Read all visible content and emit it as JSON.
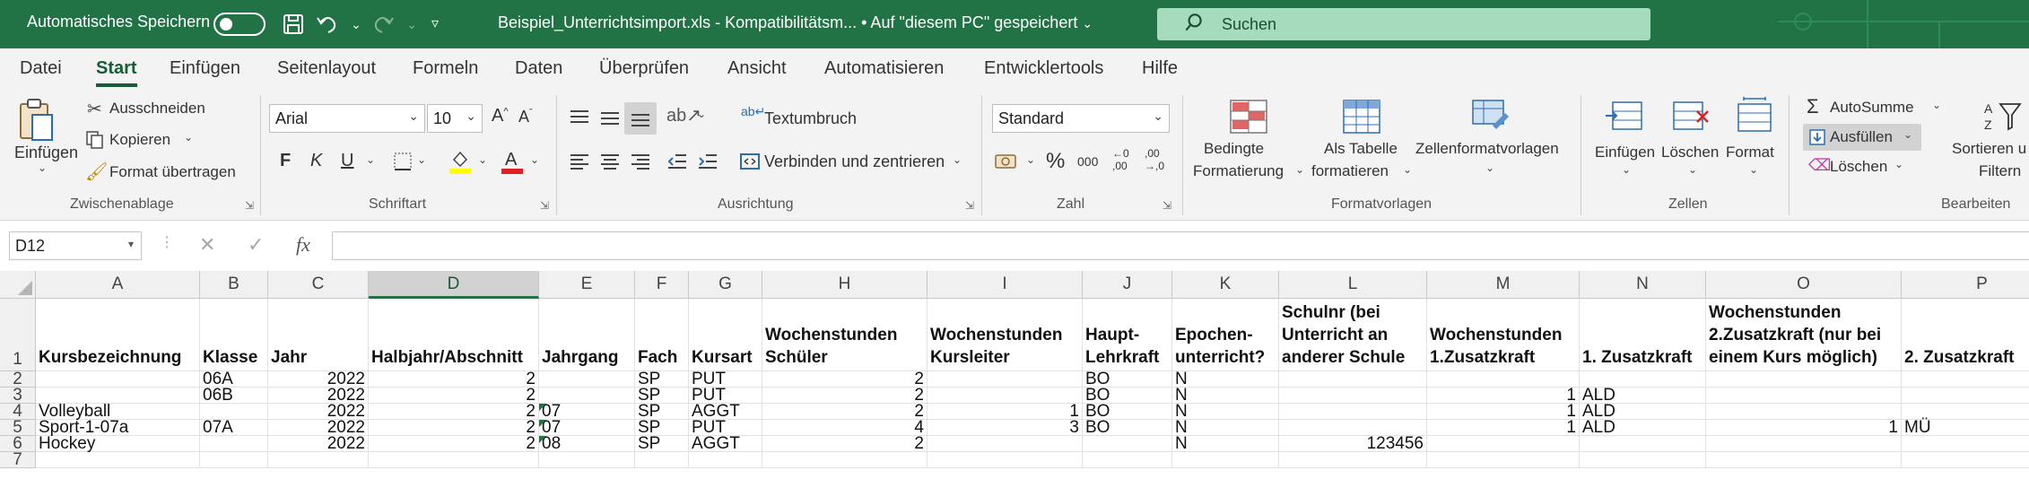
{
  "titlebar": {
    "autosave_label": "Automatisches Speichern",
    "document_title": "Beispiel_Unterrichtsimport.xls  -  Kompatibilitätsm...  •  Auf \"diesem PC\" gespeichert",
    "search_placeholder": "Suchen",
    "icons": [
      "save-icon",
      "undo-icon",
      "redo-icon",
      "customize-icon",
      "search-icon"
    ]
  },
  "menu": {
    "tabs": [
      "Datei",
      "Start",
      "Einfügen",
      "Seitenlayout",
      "Formeln",
      "Daten",
      "Überprüfen",
      "Ansicht",
      "Automatisieren",
      "Entwicklertools",
      "Hilfe"
    ],
    "active": "Start"
  },
  "ribbon": {
    "clipboard": {
      "paste": "Einfügen",
      "cut": "Ausschneiden",
      "copy": "Kopieren",
      "format_painter": "Format übertragen",
      "group": "Zwischenablage"
    },
    "font": {
      "name": "Arial",
      "size": "10",
      "bold": "F",
      "italic": "K",
      "underline": "U",
      "group": "Schriftart"
    },
    "alignment": {
      "wrap": "Textumbruch",
      "merge": "Verbinden und zentrieren",
      "group": "Ausrichtung"
    },
    "number": {
      "format": "Standard",
      "percent": "%",
      "thousands": "000",
      "group": "Zahl"
    },
    "styles": {
      "conditional_1": "Bedingte",
      "conditional_2": "Formatierung",
      "table_1": "Als Tabelle",
      "table_2": "formatieren",
      "cell_styles": "Zellenformatvorlagen",
      "group": "Formatvorlagen"
    },
    "cells": {
      "insert": "Einfügen",
      "delete": "Löschen",
      "format": "Format",
      "group": "Zellen"
    },
    "editing": {
      "autosum": "AutoSumme",
      "fill": "Ausfüllen",
      "clear": "Löschen",
      "sort_1": "Sortieren u",
      "sort_2": "Filtern",
      "group": "Bearbeiten"
    },
    "colors": {
      "accent": "#217346",
      "highlight": "#ffff00",
      "font_color": "#e02020"
    }
  },
  "formula_bar": {
    "name_box": "D12",
    "cancel": "✕",
    "enter": "✓",
    "fx": "fx",
    "value": ""
  },
  "sheet": {
    "selected_column": "D",
    "columns": [
      "A",
      "B",
      "C",
      "D",
      "E",
      "F",
      "G",
      "H",
      "I",
      "J",
      "K",
      "L",
      "M",
      "N",
      "O",
      "P"
    ],
    "row_numbers": [
      "1",
      "2",
      "3",
      "4",
      "5",
      "6",
      "7"
    ],
    "header_row": [
      "Kursbezeichnung",
      "Klasse",
      "Jahr",
      "Halbjahr/Abschnitt",
      "Jahrgang",
      "Fach",
      "Kursart",
      "Wochenstunden Schüler",
      "Wochenstunden Kursleiter",
      "Haupt-Lehrkraft",
      "Epochen-unterricht?",
      "Schulnr (bei Unterricht an anderer Schule",
      "Wochenstunden 1.Zusatzkraft",
      "1. Zusatzkraft",
      "Wochenstunden 2.Zusatzkraft (nur bei einem Kurs möglich)",
      "2. Zusatzkraft"
    ],
    "rows": [
      [
        "",
        "06A",
        "2022",
        "2",
        "",
        "SP",
        "PUT",
        "2",
        "",
        "BO",
        "N",
        "",
        "",
        "",
        "",
        ""
      ],
      [
        "",
        "06B",
        "2022",
        "2",
        "",
        "SP",
        "PUT",
        "2",
        "",
        "BO",
        "N",
        "",
        "1",
        "ALD",
        "",
        ""
      ],
      [
        "Volleyball",
        "",
        "2022",
        "2",
        "07",
        "SP",
        "AGGT",
        "2",
        "1",
        "BO",
        "N",
        "",
        "1",
        "ALD",
        "",
        ""
      ],
      [
        "Sport-1-07a",
        "07A",
        "2022",
        "2",
        "07",
        "SP",
        "PUT",
        "4",
        "3",
        "BO",
        "N",
        "",
        "1",
        "ALD",
        "1",
        "MÜ"
      ],
      [
        "Hockey",
        "",
        "2022",
        "2",
        "08",
        "SP",
        "AGGT",
        "2",
        "",
        "",
        "N",
        "123456",
        "",
        "",
        "",
        ""
      ]
    ]
  }
}
